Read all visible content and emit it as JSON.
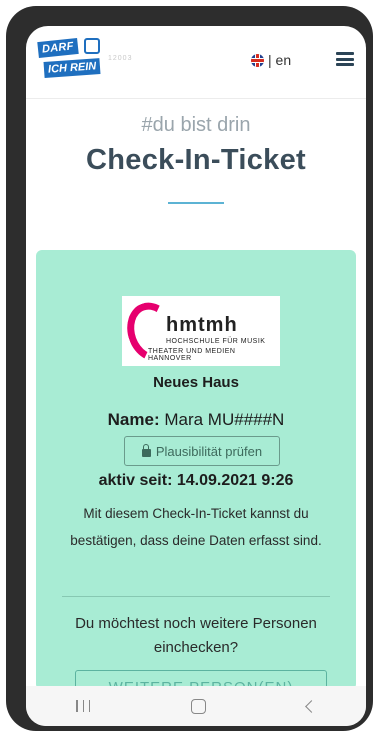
{
  "header": {
    "logo_line1": "DARF",
    "logo_line2": "ICH REIN",
    "tagline": "12003",
    "language": "| en"
  },
  "hero": {
    "subtitle": "#du bist drin",
    "title": "Check-In-Ticket"
  },
  "ticket": {
    "venue_logo": {
      "name": "hmtmh",
      "line1": "HOCHSCHULE FÜR MUSIK",
      "line2": "THEATER UND MEDIEN HANNOVER"
    },
    "venue_name": "Neues Haus",
    "name_label": "Name:",
    "name_value": "Mara MU####N",
    "check_button": "Plausibilität prüfen",
    "active_since": "aktiv seit: 14.09.2021 9:26",
    "description": "Mit diesem Check-In-Ticket kannst du bestätigen, dass deine Daten erfasst sind.",
    "more_question": "Du möchtest noch weitere Personen einchecken?",
    "more_button": "WEITERE PERSON(EN)"
  },
  "colors": {
    "card_bg": "#a8ecd4",
    "accent": "#5cb3d4",
    "brand_pink": "#e6006e",
    "logo_blue": "#1f6fbf"
  },
  "icons": [
    "uk-flag-icon",
    "hamburger-menu-icon",
    "lock-icon",
    "recent-apps-icon",
    "home-icon",
    "back-icon"
  ]
}
